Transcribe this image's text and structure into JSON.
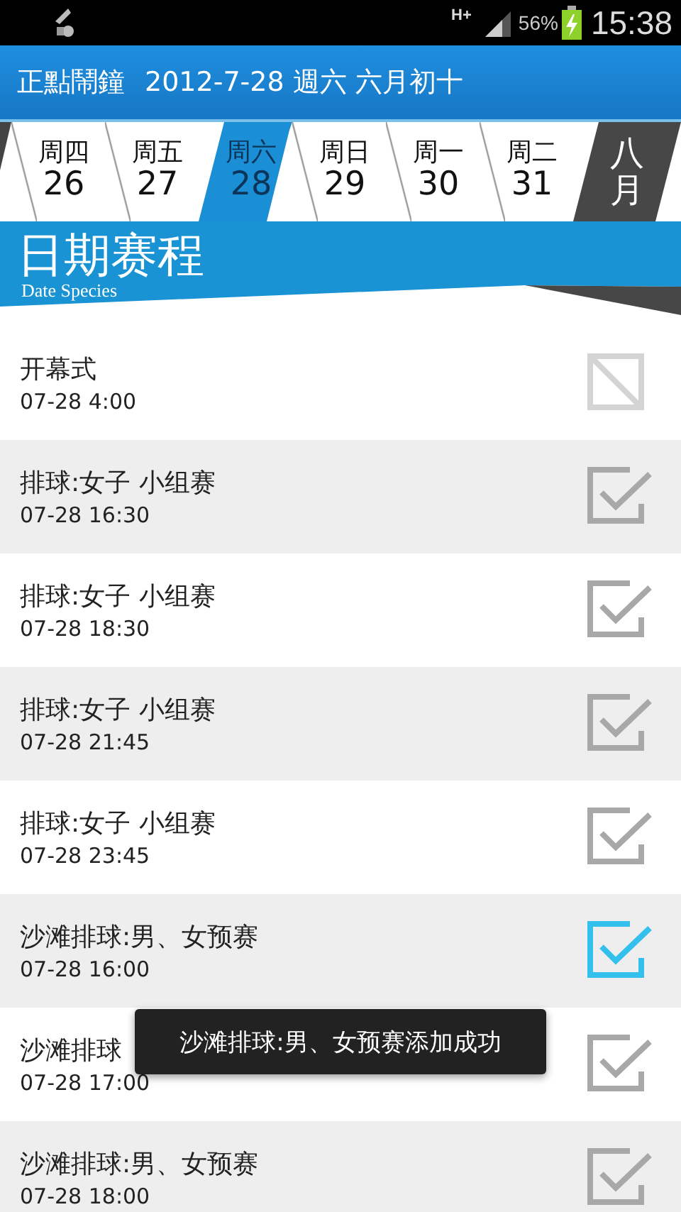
{
  "status_bar": {
    "network": "H+",
    "battery": "56%",
    "time": "15:38"
  },
  "title_bar": {
    "app_name": "正點鬧鐘",
    "date": "2012-7-28 週六 六月初十"
  },
  "days": [
    {
      "weekday": "周四",
      "date": "26",
      "selected": false
    },
    {
      "weekday": "周五",
      "date": "27",
      "selected": false
    },
    {
      "weekday": "周六",
      "date": "28",
      "selected": true
    },
    {
      "weekday": "周日",
      "date": "29",
      "selected": false
    },
    {
      "weekday": "周一",
      "date": "30",
      "selected": false
    },
    {
      "weekday": "周二",
      "date": "31",
      "selected": false
    }
  ],
  "next_month": "八月",
  "section": {
    "title": "日期赛程",
    "subtitle": "Date Species"
  },
  "events": [
    {
      "title": "开幕式",
      "time": "07-28 4:00",
      "disabled": true
    },
    {
      "title": "排球:女子 小组赛",
      "time": "07-28 16:30",
      "disabled": false,
      "added": false
    },
    {
      "title": "排球:女子 小组赛",
      "time": "07-28 18:30",
      "disabled": false,
      "added": false
    },
    {
      "title": "排球:女子 小组赛",
      "time": "07-28 21:45",
      "disabled": false,
      "added": false
    },
    {
      "title": "排球:女子 小组赛",
      "time": "07-28 23:45",
      "disabled": false,
      "added": false
    },
    {
      "title": "沙滩排球:男、女预赛",
      "time": "07-28 16:00",
      "disabled": false,
      "added": true
    },
    {
      "title": "沙滩排球",
      "time": "07-28 17:00",
      "disabled": false,
      "added": false
    },
    {
      "title": "沙滩排球:男、女预赛",
      "time": "07-28 18:00",
      "disabled": false,
      "added": false
    }
  ],
  "toast": "沙滩排球:男、女预赛添加成功"
}
